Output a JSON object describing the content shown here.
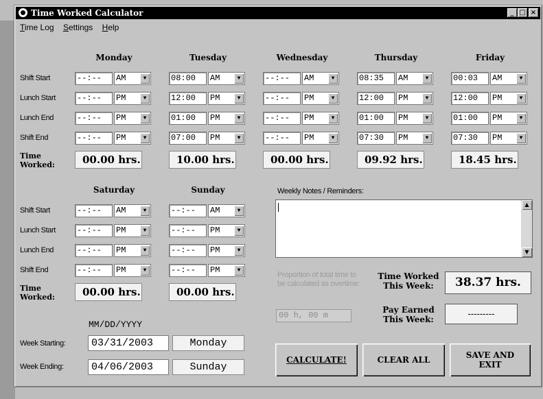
{
  "title": "Time Worked Calculator",
  "window_buttons": {
    "minimize": "_",
    "maximize": "□",
    "close": "×"
  },
  "menu": [
    {
      "label": "Time Log",
      "u": "T",
      "rest": "ime Log"
    },
    {
      "label": "Settings",
      "u": "S",
      "rest": "ettings"
    },
    {
      "label": "Help",
      "u": "H",
      "rest": "elp"
    }
  ],
  "row_labels": [
    "Shift Start",
    "Lunch Start",
    "Lunch End",
    "Shift End"
  ],
  "time_worked_label": "Time Worked:",
  "days": [
    {
      "name": "Monday",
      "rows": [
        [
          "--:--",
          "AM"
        ],
        [
          "--:--",
          "PM"
        ],
        [
          "--:--",
          "PM"
        ],
        [
          "--:--",
          "PM"
        ]
      ],
      "worked": "00.00 hrs."
    },
    {
      "name": "Tuesday",
      "rows": [
        [
          "08:00",
          "AM"
        ],
        [
          "12:00",
          "PM"
        ],
        [
          "01:00",
          "PM"
        ],
        [
          "07:00",
          "PM"
        ]
      ],
      "worked": "10.00 hrs."
    },
    {
      "name": "Wednesday",
      "rows": [
        [
          "--:--",
          "AM"
        ],
        [
          "--:--",
          "PM"
        ],
        [
          "--:--",
          "PM"
        ],
        [
          "--:--",
          "PM"
        ]
      ],
      "worked": "00.00 hrs."
    },
    {
      "name": "Thursday",
      "rows": [
        [
          "08:35",
          "AM"
        ],
        [
          "12:00",
          "PM"
        ],
        [
          "01:00",
          "PM"
        ],
        [
          "07:30",
          "PM"
        ]
      ],
      "worked": "09.92 hrs."
    },
    {
      "name": "Friday",
      "rows": [
        [
          "00:03",
          "AM"
        ],
        [
          "12:00",
          "PM"
        ],
        [
          "01:00",
          "PM"
        ],
        [
          "07:30",
          "PM"
        ]
      ],
      "worked": "18.45 hrs."
    },
    {
      "name": "Saturday",
      "rows": [
        [
          "--:--",
          "AM"
        ],
        [
          "--:--",
          "PM"
        ],
        [
          "--:--",
          "PM"
        ],
        [
          "--:--",
          "PM"
        ]
      ],
      "worked": "00.00 hrs."
    },
    {
      "name": "Sunday",
      "rows": [
        [
          "--:--",
          "AM"
        ],
        [
          "--:--",
          "PM"
        ],
        [
          "--:--",
          "PM"
        ],
        [
          "--:--",
          "PM"
        ]
      ],
      "worked": "00.00 hrs."
    }
  ],
  "notes": {
    "label": "Weekly Notes / Reminders:",
    "value": ""
  },
  "overtime": {
    "label": "Proportion of total time to be calculated as overtime:",
    "value": "00 h, 00 m"
  },
  "summary": {
    "time_worked_label": "Time Worked This Week:",
    "time_worked_value": "38.37 hrs.",
    "pay_label": "Pay Earned This Week:",
    "pay_value": "---------"
  },
  "dates": {
    "format": "MM/DD/YYYY",
    "start_label": "Week Starting:",
    "start_value": "03/31/2003",
    "start_day": "Monday",
    "end_label": "Week Ending:",
    "end_value": "04/06/2003",
    "end_day": "Sunday"
  },
  "buttons": {
    "calculate": "CALCULATE!",
    "clear_all": "CLEAR ALL",
    "save_exit": "SAVE AND EXIT"
  },
  "icons": {
    "app": "clock-icon",
    "dropdown": "chevron-down-icon"
  }
}
